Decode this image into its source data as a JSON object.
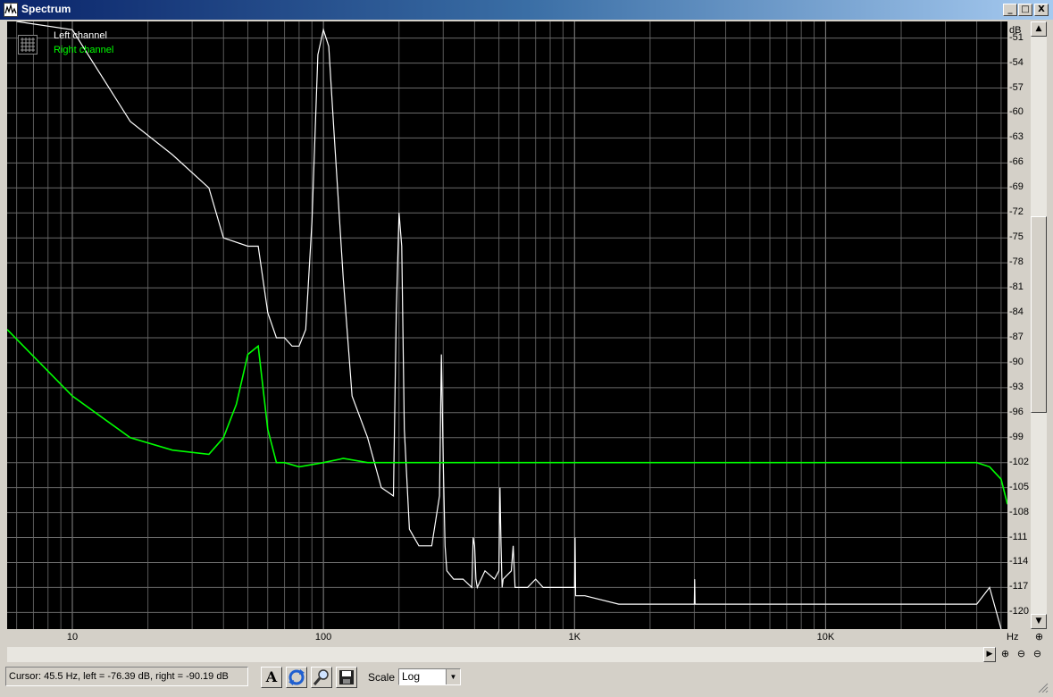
{
  "window": {
    "title": "Spectrum",
    "minimize": "_",
    "maximize": "□",
    "close": "X"
  },
  "legend": {
    "icon": "grid-icon",
    "left_label": "Left channel",
    "right_label": "Right channel",
    "left_color": "#ffffff",
    "right_color": "#00ff00"
  },
  "y_axis": {
    "unit": "dB",
    "ticks": [
      "-51",
      "-54",
      "-57",
      "-60",
      "-63",
      "-66",
      "-69",
      "-72",
      "-75",
      "-78",
      "-81",
      "-84",
      "-87",
      "-90",
      "-93",
      "-96",
      "-99",
      "-102",
      "-105",
      "-108",
      "-111",
      "-114",
      "-117",
      "-120"
    ]
  },
  "x_axis": {
    "unit": "Hz",
    "ticks": [
      "10",
      "100",
      "1K",
      "10K"
    ]
  },
  "status": {
    "cursor_text": "Cursor:  45.5 Hz,  left = -76.39 dB,  right = -90.19 dB",
    "scale_label": "Scale",
    "scale_value": "Log"
  },
  "toolbar": {
    "font_button": "A",
    "icons": [
      "font-icon",
      "refresh-icon",
      "search-icon",
      "save-icon"
    ]
  },
  "chart_data": {
    "type": "line",
    "x_scale": "log",
    "xlim": [
      5.5,
      53000
    ],
    "ylim": [
      -122,
      -49
    ],
    "grid": true,
    "legend_position": "top-left",
    "xlabel": "Hz",
    "ylabel": "dB",
    "series": [
      {
        "name": "Left channel",
        "color": "#ffffff",
        "x": [
          6,
          10,
          17,
          25,
          35,
          40,
          50,
          55,
          60,
          65,
          70,
          75,
          80,
          85,
          90,
          95,
          100,
          105,
          110,
          120,
          130,
          150,
          170,
          190,
          195,
          200,
          205,
          210,
          220,
          240,
          270,
          290,
          295,
          300,
          305,
          310,
          330,
          360,
          390,
          395,
          400,
          405,
          410,
          440,
          480,
          500,
          505,
          510,
          515,
          520,
          560,
          570,
          580,
          590,
          600,
          650,
          700,
          750,
          800,
          850,
          900,
          950,
          1000,
          1005,
          1010,
          1100,
          1500,
          2000,
          3000,
          3010,
          3020,
          4000,
          6000,
          10000,
          15000,
          20000,
          30000,
          40000,
          45000,
          50000
        ],
        "y": [
          -49,
          -50,
          -61,
          -65,
          -69,
          -75,
          -76,
          -76,
          -84,
          -87,
          -87,
          -88,
          -88,
          -86,
          -73,
          -53,
          -50,
          -52,
          -62,
          -80,
          -94,
          -99,
          -105,
          -106,
          -84,
          -72,
          -76,
          -98,
          -110,
          -112,
          -112,
          -106,
          -89,
          -102,
          -112,
          -115,
          -116,
          -116,
          -117,
          -111,
          -112,
          -116,
          -117,
          -115,
          -116,
          -115,
          -105,
          -112,
          -117,
          -116,
          -115,
          -112,
          -117,
          -117,
          -117,
          -117,
          -116,
          -117,
          -117,
          -117,
          -117,
          -117,
          -117,
          -111,
          -118,
          -118,
          -119,
          -119,
          -119,
          -116,
          -119,
          -119,
          -119,
          -119,
          -119,
          -119,
          -119,
          -119,
          -117,
          -122
        ]
      },
      {
        "name": "Right channel",
        "color": "#00ff00",
        "x": [
          5.5,
          10,
          17,
          25,
          35,
          40,
          45,
          50,
          55,
          60,
          65,
          70,
          80,
          100,
          120,
          150,
          200,
          300,
          500,
          1000,
          2000,
          5000,
          10000,
          20000,
          30000,
          40000,
          45000,
          50000,
          53000
        ],
        "y": [
          -86,
          -94,
          -99,
          -100.5,
          -101,
          -99,
          -95,
          -89,
          -88,
          -98,
          -102,
          -102,
          -102.5,
          -102,
          -101.5,
          -102,
          -102,
          -102,
          -102,
          -102,
          -102,
          -102,
          -102,
          -102,
          -102,
          -102,
          -102.5,
          -104,
          -107
        ]
      }
    ]
  }
}
